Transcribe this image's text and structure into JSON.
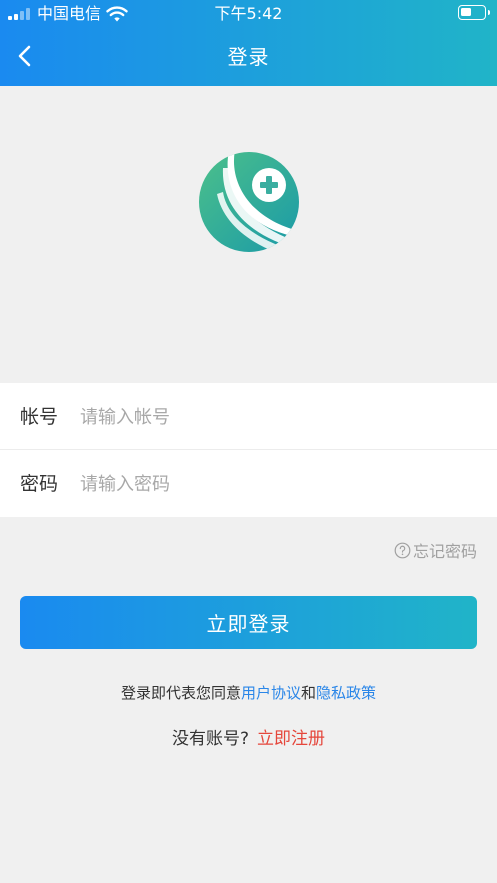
{
  "status_bar": {
    "carrier": "中国电信",
    "time": "下午5:42",
    "wifi_icon": "wifi-icon",
    "battery_icon": "battery-icon"
  },
  "header": {
    "title": "登录",
    "back_icon": "chevron-left-icon",
    "gradient_from": "#1a8af0",
    "gradient_to": "#20b4c8"
  },
  "logo": {
    "icon": "medical-cross-logo",
    "color_from": "#4cc08a",
    "color_to": "#1a9aa8"
  },
  "form": {
    "account_label": "帐号",
    "account_placeholder": "请输入帐号",
    "account_value": "",
    "password_label": "密码",
    "password_placeholder": "请输入密码",
    "password_value": ""
  },
  "forgot": {
    "label": "忘记密码",
    "icon": "question-circle-icon"
  },
  "login_button": {
    "label": "立即登录"
  },
  "agreement": {
    "prefix": "登录即代表您同意",
    "user_agreement": "用户协议",
    "conjunction": "和",
    "privacy_policy": "隐私政策",
    "link_color": "#2a86e8"
  },
  "register": {
    "prompt": "没有账号?",
    "link": "立即注册",
    "link_color": "#e5463b"
  }
}
